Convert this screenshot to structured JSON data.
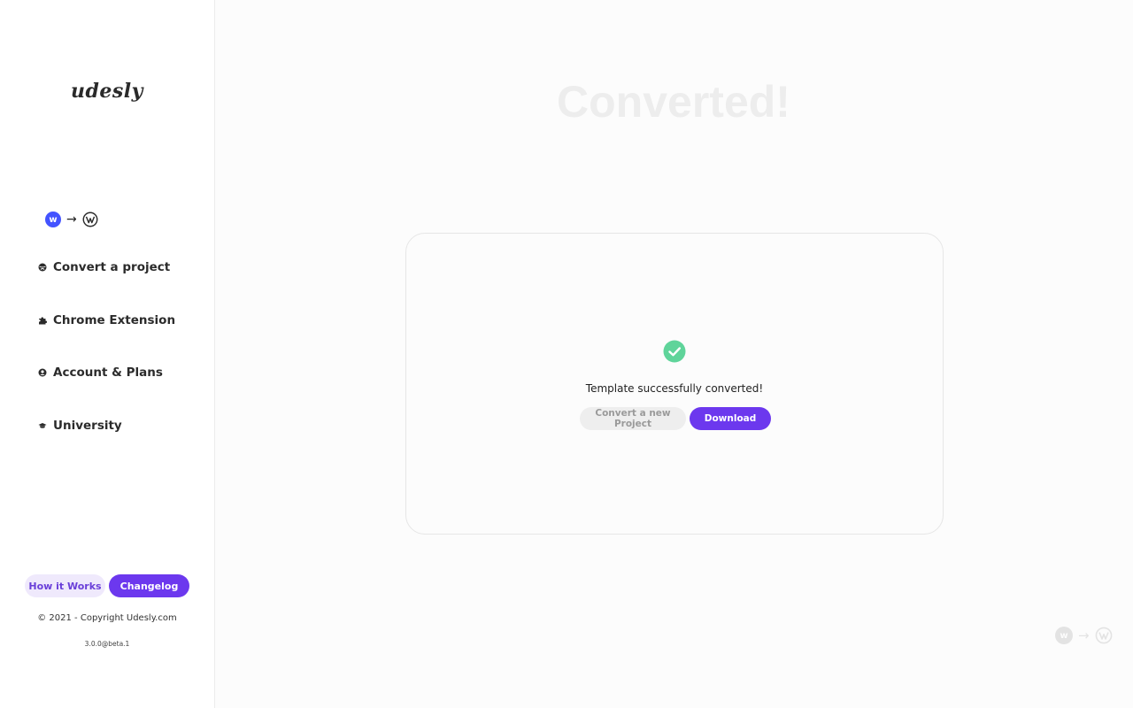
{
  "sidebar": {
    "logo": "udesly",
    "platforms": {
      "from_badge": "w",
      "arrow": "→"
    },
    "nav": [
      {
        "label": "Convert a project",
        "icon": "globe-icon"
      },
      {
        "label": "Chrome Extension",
        "icon": "puzzle-icon"
      },
      {
        "label": "Account & Plans",
        "icon": "user-circle-icon"
      },
      {
        "label": "University",
        "icon": "graduation-cap-icon"
      }
    ],
    "how_it_works_label": "How it Works",
    "changelog_label": "Changelog",
    "copyright": "© 2021 - Copyright Udesly.com",
    "version": "3.0.0@beta.1"
  },
  "main": {
    "title": "Converted!",
    "success_message": "Template successfully converted!",
    "convert_new_label": "Convert a new Project",
    "download_label": "Download"
  },
  "corner": {
    "from_badge": "w",
    "arrow": "→"
  },
  "colors": {
    "accent": "#6c38ee",
    "webflow_blue": "#4353ff",
    "success_green": "#5fd49a",
    "title_gray": "#ededed"
  }
}
